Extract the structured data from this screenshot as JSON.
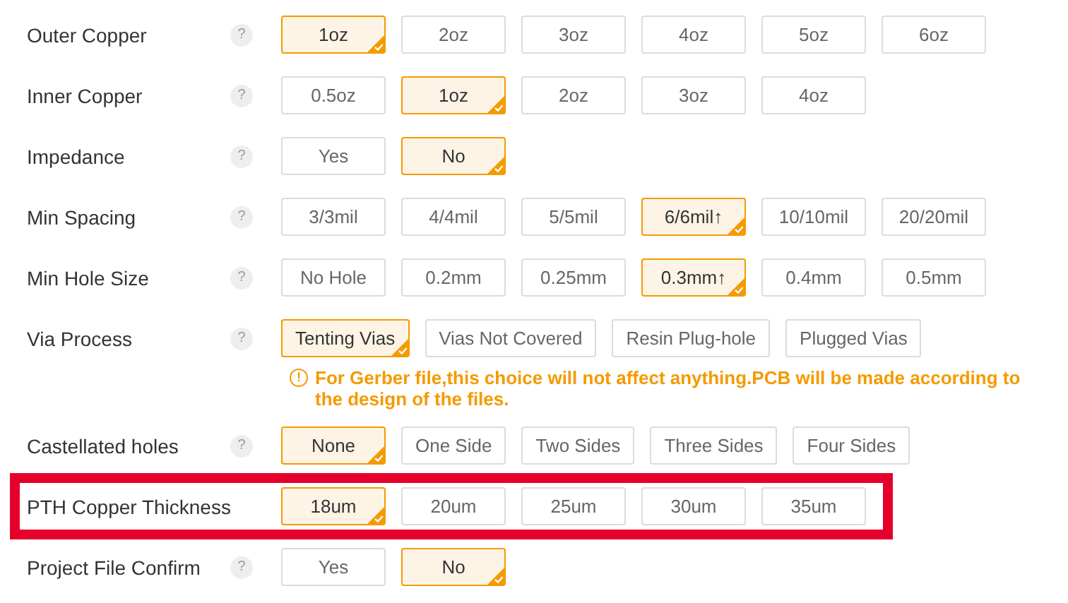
{
  "rows": [
    {
      "label": "Outer Copper",
      "help": "?",
      "highlighted": false,
      "options": [
        {
          "label": "1oz",
          "selected": true
        },
        {
          "label": "2oz",
          "selected": false
        },
        {
          "label": "3oz",
          "selected": false
        },
        {
          "label": "4oz",
          "selected": false
        },
        {
          "label": "5oz",
          "selected": false
        },
        {
          "label": "6oz",
          "selected": false
        }
      ]
    },
    {
      "label": "Inner Copper",
      "help": "?",
      "highlighted": false,
      "options": [
        {
          "label": "0.5oz",
          "selected": false
        },
        {
          "label": "1oz",
          "selected": true
        },
        {
          "label": "2oz",
          "selected": false
        },
        {
          "label": "3oz",
          "selected": false
        },
        {
          "label": "4oz",
          "selected": false
        }
      ]
    },
    {
      "label": "Impedance",
      "help": "?",
      "highlighted": false,
      "options": [
        {
          "label": "Yes",
          "selected": false
        },
        {
          "label": "No",
          "selected": true
        }
      ]
    },
    {
      "label": "Min Spacing",
      "help": "?",
      "highlighted": false,
      "options": [
        {
          "label": "3/3mil",
          "selected": false
        },
        {
          "label": "4/4mil",
          "selected": false
        },
        {
          "label": "5/5mil",
          "selected": false
        },
        {
          "label": "6/6mil↑",
          "selected": true
        },
        {
          "label": "10/10mil",
          "selected": false
        },
        {
          "label": "20/20mil",
          "selected": false
        }
      ]
    },
    {
      "label": "Min Hole Size",
      "help": "?",
      "highlighted": false,
      "options": [
        {
          "label": "No Hole",
          "selected": false
        },
        {
          "label": "0.2mm",
          "selected": false
        },
        {
          "label": "0.25mm",
          "selected": false
        },
        {
          "label": "0.3mm↑",
          "selected": true
        },
        {
          "label": "0.4mm",
          "selected": false
        },
        {
          "label": "0.5mm",
          "selected": false
        }
      ]
    },
    {
      "label": "Via Process",
      "help": "?",
      "highlighted": false,
      "options": [
        {
          "label": "Tenting Vias",
          "selected": true
        },
        {
          "label": "Vias Not Covered",
          "selected": false
        },
        {
          "label": "Resin Plug-hole",
          "selected": false
        },
        {
          "label": "Plugged Vias",
          "selected": false
        }
      ],
      "note": {
        "icon": "!",
        "text": "For Gerber file,this choice will not affect anything.PCB will be made according to the design of the files."
      }
    },
    {
      "label": "Castellated holes",
      "help": "?",
      "highlighted": false,
      "options": [
        {
          "label": "None",
          "selected": true
        },
        {
          "label": "One Side",
          "selected": false
        },
        {
          "label": "Two Sides",
          "selected": false
        },
        {
          "label": "Three Sides",
          "selected": false
        },
        {
          "label": "Four Sides",
          "selected": false
        }
      ]
    },
    {
      "label": "PTH Copper Thickness",
      "highlighted": true,
      "options": [
        {
          "label": "18um",
          "selected": true
        },
        {
          "label": "20um",
          "selected": false
        },
        {
          "label": "25um",
          "selected": false
        },
        {
          "label": "30um",
          "selected": false
        },
        {
          "label": "35um",
          "selected": false
        }
      ]
    },
    {
      "label": "Project File Confirm",
      "help": "?",
      "highlighted": false,
      "options": [
        {
          "label": "Yes",
          "selected": false
        },
        {
          "label": "No",
          "selected": true
        }
      ]
    }
  ]
}
